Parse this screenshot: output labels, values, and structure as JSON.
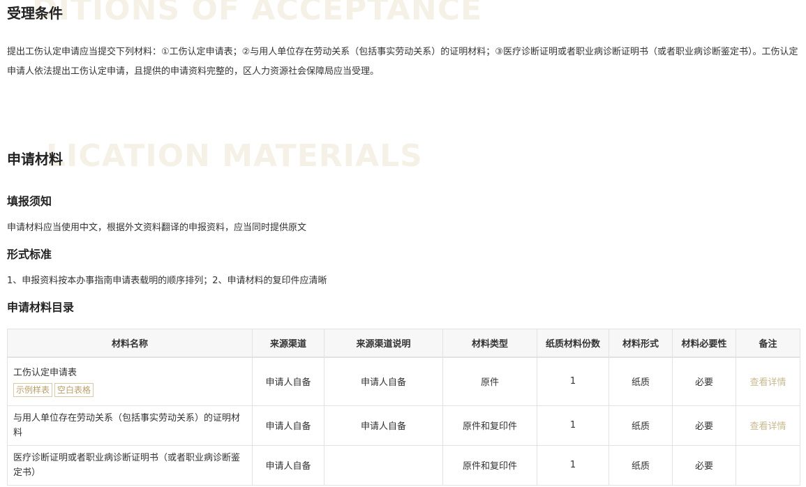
{
  "conditions": {
    "title": "受理条件",
    "bg_text": "DITIONS OF ACCEPTANCE",
    "body": "提出工伤认定申请应当提交下列材料：①工伤认定申请表；②与用人单位存在劳动关系（包括事实劳动关系）的证明材料；③医疗诊断证明或者职业病诊断证明书（或者职业病诊断鉴定书）。工伤认定申请人依法提出工伤认定申请，且提供的申请资料完整的，区人力资源社会保障局应当受理。"
  },
  "materials": {
    "title": "申请材料",
    "bg_text": "LICATION MATERIALS",
    "notice_title": "填报须知",
    "notice_text": "申请材料应当使用中文，根据外文资料翻译的申报资料，应当同时提供原文",
    "format_title": "形式标准",
    "format_text": "1、申报资料按本办事指南申请表载明的顺序排列；2、申请材料的复印件应清晰",
    "list_title": "申请材料目录"
  },
  "table": {
    "headers": [
      "材料名称",
      "来源渠道",
      "来源渠道说明",
      "材料类型",
      "纸质材料份数",
      "材料形式",
      "材料必要性",
      "备注"
    ],
    "rows": [
      {
        "name": "工伤认定申请表",
        "tag1": "示例样表",
        "tag2": "空白表格",
        "source": "申请人自备",
        "source_desc": "申请人自备",
        "type": "原件",
        "copies": "1",
        "form": "纸质",
        "necessity": "必要",
        "note": "查看详情"
      },
      {
        "name": "与用人单位存在劳动关系（包括事实劳动关系）的证明材料",
        "source": "申请人自备",
        "source_desc": "申请人自备",
        "type": "原件和复印件",
        "copies": "1",
        "form": "纸质",
        "necessity": "必要",
        "note": "查看详情"
      },
      {
        "name": "医疗诊断证明或者职业病诊断证明书（或者职业病诊断鉴定书）",
        "source": "申请人自备",
        "source_desc": "",
        "type": "原件和复印件",
        "copies": "1",
        "form": "纸质",
        "necessity": "必要",
        "note": ""
      }
    ]
  }
}
